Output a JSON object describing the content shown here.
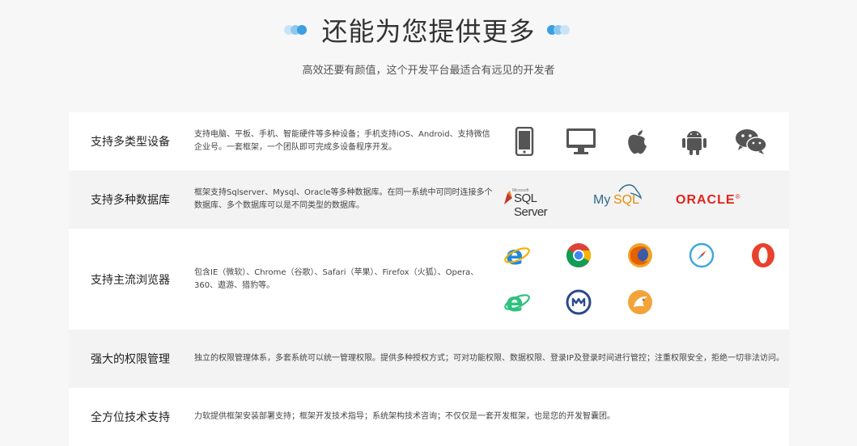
{
  "header": {
    "title": "还能为您提供更多",
    "subtitle": "高效还要有颜值，这个开发平台最适合有远见的开发者"
  },
  "rows": [
    {
      "label": "支持多类型设备",
      "desc": "支持电脑、平板、手机、智能硬件等多种设备；手机支持iOS、Android、支持微信企业号。一套框架，一个团队即可完成多设备程序开发。",
      "icons": [
        "mobile-phone-icon",
        "desktop-monitor-icon",
        "apple-icon",
        "android-icon",
        "wechat-icon"
      ]
    },
    {
      "label": "支持多种数据库",
      "desc": "框架支持Sqlserver、Mysql、Oracle等多种数据库。在同一系统中可同时连接多个数据库、多个数据库可以是不同类型的数据库。",
      "logos": {
        "sqlserver_prefix": "Microsoft",
        "sqlserver": "SQL Server",
        "mysql_a": "My",
        "mysql_b": "SQL",
        "oracle": "ORACLE",
        "oracle_mark": "®"
      }
    },
    {
      "label": "支持主流浏览器",
      "desc": "包含IE（微软）、Chrome（谷歌）、Safari（苹果）、Firefox（火狐）、Opera、360、遨游、猎豹等。",
      "icons": [
        "ie-icon",
        "chrome-icon",
        "firefox-icon",
        "safari-icon",
        "opera-icon",
        "360-browser-icon",
        "maxthon-icon",
        "liebao-browser-icon"
      ]
    },
    {
      "label": "强大的权限管理",
      "desc": "独立的权限管理体系，多套系统可以统一管理权限。提供多种授权方式；可对功能权限、数据权限、登录IP及登录时间进行管控；注重权限安全，拒绝一切非法访问。"
    },
    {
      "label": "全方位技术支持",
      "desc": "力软提供框架安装部署支持；框架开发技术指导；系统架构技术咨询；不仅仅是一套开发框架，也是您的开发智囊团。"
    }
  ],
  "colors": {
    "dot_light": "#c9e4f7",
    "dot_mid": "#8fc8ef",
    "dot_dark": "#3c9fe0",
    "icon_grey": "#555555",
    "oracle_red": "#e2231a",
    "mysql_blue": "#2e6d8c",
    "mysql_orange": "#e48e00"
  }
}
